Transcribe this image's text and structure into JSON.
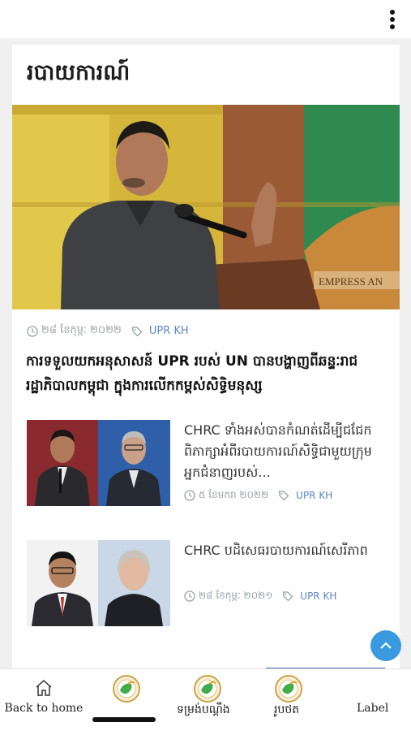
{
  "topbar": {
    "menu_icon": "more-vertical-icon"
  },
  "section": {
    "title": "របាយការណ៍"
  },
  "featured": {
    "date": "២៨ ខែកុម្ភៈ ២០២២",
    "tag": "UPR KH",
    "headline": "ការទទួលយកអនុសាសន៍ UPR របស់ UN បានបង្ហាញពីឆន្ទៈរាជរដ្ឋាភិបាលកម្ពុជា ក្នុងការលើកកម្ពស់សិទ្ធិមនុស្ស"
  },
  "articles": [
    {
      "title": "CHRC ទាំងអស់បានកំណត់ដើម្បីជជែកពិភាក្សាអំពីរបាយការណ៍សិទ្ធិជាមួយក្រុមអ្នកជំនាញរបស់...",
      "date": "៥ ខែមករា ២០២២",
      "tag": "UPR KH"
    },
    {
      "title": "CHRC បដិសេធរបាយការណ៍សេរីភាព",
      "date": "២៨ ខែកុម្ភៈ ២០២១",
      "tag": "UPR KH"
    }
  ],
  "bottom_nav": [
    {
      "label": "Back to home",
      "icon": "home-icon"
    },
    {
      "label": "",
      "icon": "logo-icon"
    },
    {
      "label": "ទម្រង់បណ្តឹង",
      "icon": "logo-icon"
    },
    {
      "label": "រូបថត",
      "icon": "logo-icon"
    },
    {
      "label": "Label",
      "icon": ""
    }
  ],
  "colors": {
    "accent": "#3a9ae0",
    "tag": "#5b86c9",
    "meta": "#9aa0a6"
  }
}
